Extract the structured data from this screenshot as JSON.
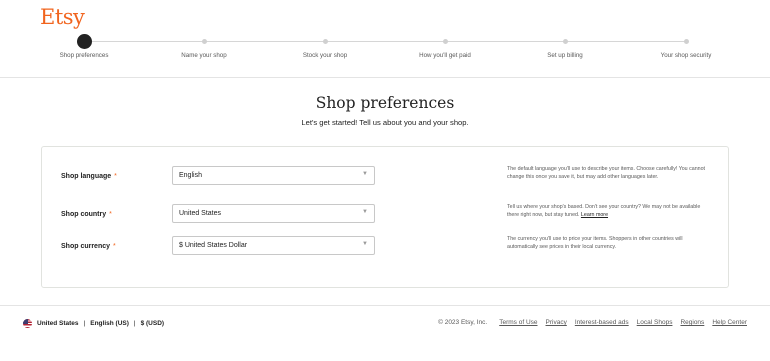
{
  "brand": {
    "logo_text": "Etsy",
    "accent_color": "#F1641E"
  },
  "stepper": {
    "steps": [
      {
        "label": "Shop preferences",
        "active": true
      },
      {
        "label": "Name your shop",
        "active": false
      },
      {
        "label": "Stock your shop",
        "active": false
      },
      {
        "label": "How you'll get paid",
        "active": false
      },
      {
        "label": "Set up billing",
        "active": false
      },
      {
        "label": "Your shop security",
        "active": false
      }
    ]
  },
  "header": {
    "title": "Shop preferences",
    "subtitle": "Let's get started! Tell us about you and your shop."
  },
  "form": {
    "language": {
      "label": "Shop language",
      "required_mark": "*",
      "value": "English",
      "help": "The default language you'll use to describe your items. Choose carefully! You cannot change this once you save it, but may add other languages later."
    },
    "country": {
      "label": "Shop country",
      "required_mark": "*",
      "value": "United States",
      "help": "Tell us where your shop's based. Don't see your country? We may not be available there right now, but stay tuned.",
      "help_link": "Learn more"
    },
    "currency": {
      "label": "Shop currency",
      "required_mark": "*",
      "value": "$ United States Dollar",
      "help": "The currency you'll use to price your items. Shoppers in other countries will automatically see prices in their local currency."
    }
  },
  "footer": {
    "region": "United States",
    "language": "English (US)",
    "currency": "$ (USD)",
    "separator": "|",
    "copyright": "© 2023 Etsy, Inc.",
    "links": [
      "Terms of Use",
      "Privacy",
      "Interest-based ads",
      "Local Shops",
      "Regions",
      "Help Center"
    ]
  }
}
